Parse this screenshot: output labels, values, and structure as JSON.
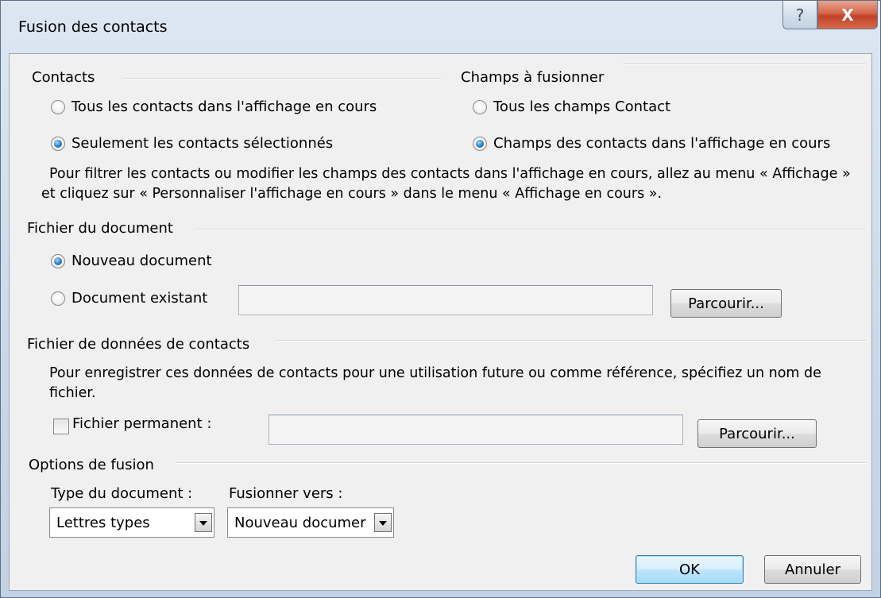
{
  "window": {
    "title": "Fusion des contacts",
    "help_glyph": "?",
    "close_glyph": "X"
  },
  "contacts": {
    "heading": "Contacts",
    "option_all": "Tous les contacts dans l'affichage en cours",
    "option_selected": "Seulement les contacts sélectionnés",
    "selected": "option_selected"
  },
  "fields": {
    "heading": "Champs à fusionner",
    "option_all": "Tous les champs Contact",
    "option_view": "Champs des contacts dans l'affichage en cours",
    "selected": "option_view"
  },
  "filter_info": {
    "line1": "Pour filtrer les contacts ou modifier les champs des contacts dans l'affichage en cours, allez au menu « Affichage »",
    "line2": "et cliquez sur « Personnaliser l'affichage en cours » dans le menu « Affichage en cours »."
  },
  "document_file": {
    "heading": "Fichier du document",
    "option_new": "Nouveau document",
    "option_existing": "Document existant",
    "selected": "option_new",
    "existing_path_value": "",
    "browse_label": "Parcourir..."
  },
  "contact_data_file": {
    "heading": "Fichier de données de contacts",
    "info_line1": "Pour enregistrer ces données de contacts pour une utilisation future ou comme référence, spécifiez un nom de",
    "info_line2": "fichier.",
    "permanent_label": "Fichier permanent :",
    "permanent_checked": false,
    "path_value": "",
    "browse_label": "Parcourir..."
  },
  "merge_options": {
    "heading": "Options de fusion",
    "document_type_label": "Type du document :",
    "document_type_value": "Lettres types",
    "merge_to_label": "Fusionner vers :",
    "merge_to_value": "Nouveau documer"
  },
  "buttons": {
    "ok": "OK",
    "cancel": "Annuler"
  }
}
